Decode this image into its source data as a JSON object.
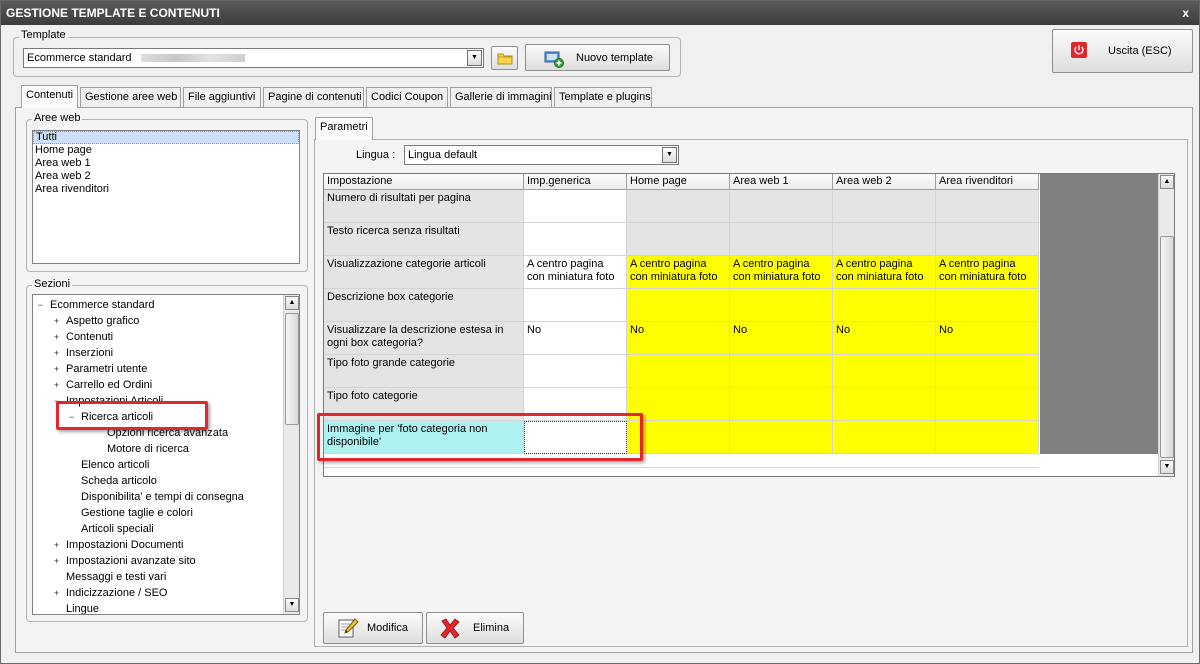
{
  "window": {
    "title": "GESTIONE TEMPLATE E CONTENUTI",
    "close_glyph": "x"
  },
  "template": {
    "group_label": "Template",
    "selected": "Ecommerce standard",
    "folder_icon": "folder-icon",
    "new_button": "Nuovo template",
    "new_icon": "new-template-icon"
  },
  "exit_button": {
    "label": "Uscita (ESC)",
    "icon": "power-icon",
    "color": "#e3262b"
  },
  "tabs": [
    {
      "label": "Contenuti",
      "active": true
    },
    {
      "label": "Gestione aree web",
      "active": false
    },
    {
      "label": "File aggiuntivi",
      "active": false
    },
    {
      "label": "Pagine di contenuti",
      "active": false
    },
    {
      "label": "Codici Coupon",
      "active": false
    },
    {
      "label": "Gallerie di immagini",
      "active": false
    },
    {
      "label": "Template e plugins",
      "active": false
    }
  ],
  "aree_web": {
    "label": "Aree web",
    "items": [
      "Tutti",
      "Home page",
      "Area web 1",
      "Area web 2",
      "Area rivenditori"
    ],
    "selected_index": 0
  },
  "sezioni": {
    "label": "Sezioni",
    "tree": [
      {
        "label": "Ecommerce standard",
        "level": 0,
        "exp": "−"
      },
      {
        "label": "Aspetto grafico",
        "level": 1,
        "exp": "+"
      },
      {
        "label": "Contenuti",
        "level": 1,
        "exp": "+"
      },
      {
        "label": "Inserzioni",
        "level": 1,
        "exp": "+"
      },
      {
        "label": "Parametri utente",
        "level": 1,
        "exp": "+"
      },
      {
        "label": "Carrello ed Ordini",
        "level": 1,
        "exp": "+"
      },
      {
        "label": "Impostazioni Articoli",
        "level": 1,
        "exp": "−"
      },
      {
        "label": "Ricerca articoli",
        "level": 2,
        "exp": "−"
      },
      {
        "label": "Opzioni ricerca avanzata",
        "level": 3,
        "exp": ""
      },
      {
        "label": "Motore di ricerca",
        "level": 3,
        "exp": ""
      },
      {
        "label": "Elenco articoli",
        "level": 2,
        "exp": ""
      },
      {
        "label": "Scheda articolo",
        "level": 2,
        "exp": ""
      },
      {
        "label": "Disponibilita' e tempi di consegna",
        "level": 2,
        "exp": ""
      },
      {
        "label": "Gestione taglie e colori",
        "level": 2,
        "exp": ""
      },
      {
        "label": "Articoli speciali",
        "level": 2,
        "exp": ""
      },
      {
        "label": "Impostazioni Documenti",
        "level": 1,
        "exp": "+"
      },
      {
        "label": "Impostazioni avanzate sito",
        "level": 1,
        "exp": "+"
      },
      {
        "label": "Messaggi e testi vari",
        "level": 1,
        "exp": ""
      },
      {
        "label": "Indicizzazione / SEO",
        "level": 1,
        "exp": "+"
      },
      {
        "label": "Lingue",
        "level": 1,
        "exp": ""
      }
    ]
  },
  "parametri": {
    "tab_label": "Parametri",
    "lingua_label": "Lingua :",
    "lingua_value": "Lingua default"
  },
  "grid": {
    "columns": [
      "Impostazione",
      "Imp.generica",
      "Home page",
      "Area web 1",
      "Area web 2",
      "Area rivenditori"
    ],
    "rows": [
      {
        "name": "Numero di risultati per pagina",
        "generic": "",
        "values": [
          "",
          "",
          "",
          ""
        ],
        "override": false
      },
      {
        "name": "Testo ricerca senza risultati",
        "generic": "",
        "values": [
          "",
          "",
          "",
          ""
        ],
        "override": false
      },
      {
        "name": "Visualizzazione categorie articoli",
        "generic": "A centro pagina con miniatura foto",
        "values": [
          "A centro pagina con miniatura foto",
          "A centro pagina con miniatura foto",
          "A centro pagina con miniatura foto",
          "A centro pagina con miniatura foto"
        ],
        "override": true
      },
      {
        "name": "Descrizione box categorie",
        "generic": "",
        "values": [
          "",
          "",
          "",
          ""
        ],
        "override": true
      },
      {
        "name": "Visualizzare la descrizione estesa in ogni box categoria?",
        "generic": "No",
        "values": [
          "No",
          "No",
          "No",
          "No"
        ],
        "override": true
      },
      {
        "name": "Tipo foto grande categorie",
        "generic": "",
        "values": [
          "",
          "",
          "",
          ""
        ],
        "override": true
      },
      {
        "name": "Tipo foto categorie",
        "generic": "",
        "values": [
          "",
          "",
          "",
          ""
        ],
        "override": true
      },
      {
        "name": "Immagine per 'foto categoria non disponibile'",
        "generic": "",
        "values": [
          "",
          "",
          "",
          ""
        ],
        "override": true,
        "selected": true
      }
    ],
    "colors": {
      "override": "#ffff00",
      "disabled": "#e4e4e4",
      "selected_row": "#aef1f1",
      "empty_area": "#808080"
    }
  },
  "actions": {
    "modifica": "Modifica",
    "modifica_icon": "edit-icon",
    "elimina": "Elimina",
    "elimina_icon": "delete-icon"
  }
}
